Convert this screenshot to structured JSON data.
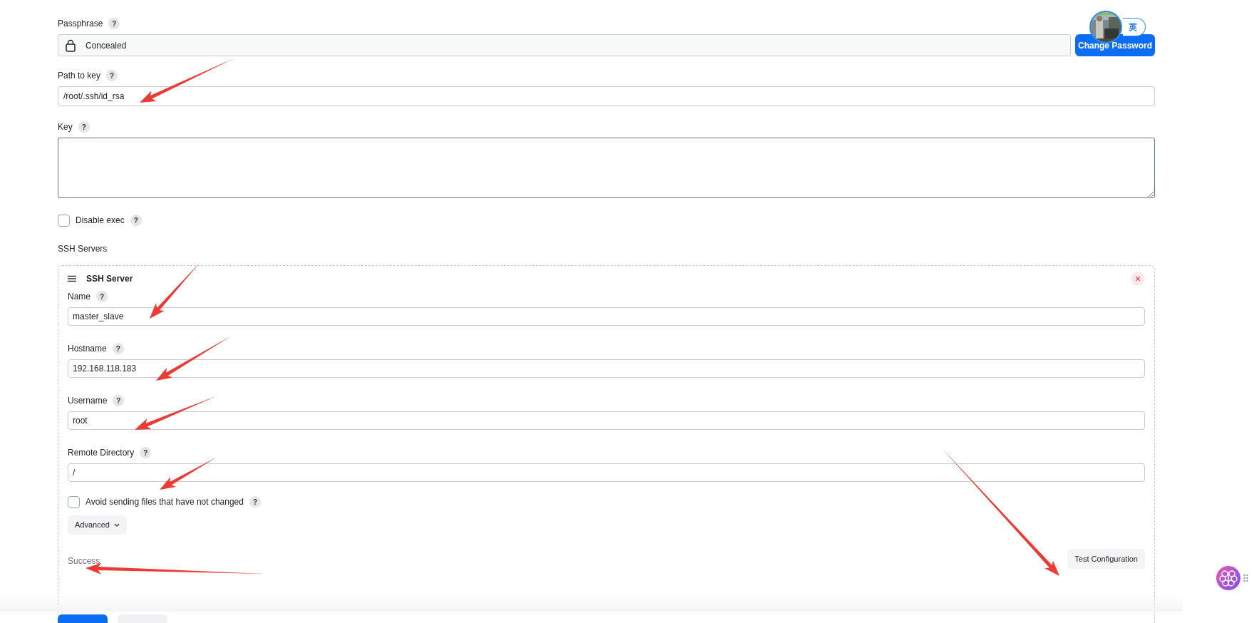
{
  "passphrase": {
    "label": "Passphrase",
    "help": "?",
    "value": "Concealed",
    "button": "Change Password"
  },
  "path_to_key": {
    "label": "Path to key",
    "help": "?",
    "value": "/root/.ssh/id_rsa"
  },
  "key": {
    "label": "Key",
    "help": "?"
  },
  "disable_exec": {
    "label": "Disable exec",
    "help": "?",
    "checked": false
  },
  "ssh_servers": {
    "label": "SSH Servers",
    "server": {
      "title": "SSH Server",
      "close": "×",
      "fields": [
        {
          "label": "Name",
          "help": "?",
          "value": "master_slave"
        },
        {
          "label": "Hostname",
          "help": "?",
          "value": "192.168.118.183"
        },
        {
          "label": "Username",
          "help": "?",
          "value": "root"
        },
        {
          "label": "Remote Directory",
          "help": "?",
          "value": "/"
        }
      ],
      "avoid_sending": {
        "label": "Avoid sending files that have not changed",
        "help": "?",
        "checked": false
      },
      "advanced": "Advanced",
      "status": "Success",
      "test_button": "Test Configuration"
    }
  },
  "ime_badge": "英"
}
